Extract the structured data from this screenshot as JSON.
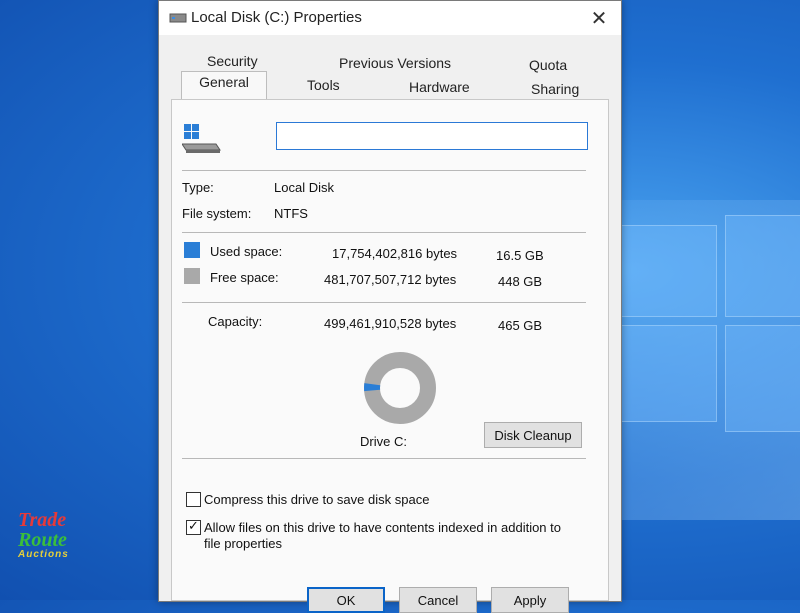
{
  "window": {
    "title": "Local Disk (C:) Properties",
    "close_glyph": "✕"
  },
  "tabs": [
    {
      "label": "Security"
    },
    {
      "label": "Previous Versions"
    },
    {
      "label": "Quota"
    },
    {
      "label": "General",
      "active": true
    },
    {
      "label": "Tools"
    },
    {
      "label": "Hardware"
    },
    {
      "label": "Sharing"
    }
  ],
  "general": {
    "drive_name_value": "",
    "type_label": "Type:",
    "type_value": "Local Disk",
    "fs_label": "File system:",
    "fs_value": "NTFS",
    "used_label": "Used space:",
    "used_bytes": "17,754,402,816 bytes",
    "used_gb": "16.5 GB",
    "free_label": "Free space:",
    "free_bytes": "481,707,507,712 bytes",
    "free_gb": "448 GB",
    "capacity_label": "Capacity:",
    "capacity_bytes": "499,461,910,528 bytes",
    "capacity_gb": "465 GB",
    "used_fraction": 0.0355,
    "drive_label": "Drive C:",
    "cleanup_label": "Disk Cleanup",
    "compress_label": "Compress this drive to save disk space",
    "compress_checked": false,
    "index_label_line1": "Allow files on this drive to have contents indexed in addition to",
    "index_label_line2": "file properties",
    "index_checked": true
  },
  "buttons": {
    "ok": "OK",
    "cancel": "Cancel",
    "apply": "Apply"
  },
  "colors": {
    "used": "#2a7ed6",
    "free": "#a9a9a9",
    "accent": "#0a64c8"
  },
  "icons": {
    "title": "drive-icon",
    "drive_large": "windows-drive-icon"
  },
  "watermark": {
    "line1": "Trade",
    "line2": "Route",
    "line3": "Auctions"
  }
}
